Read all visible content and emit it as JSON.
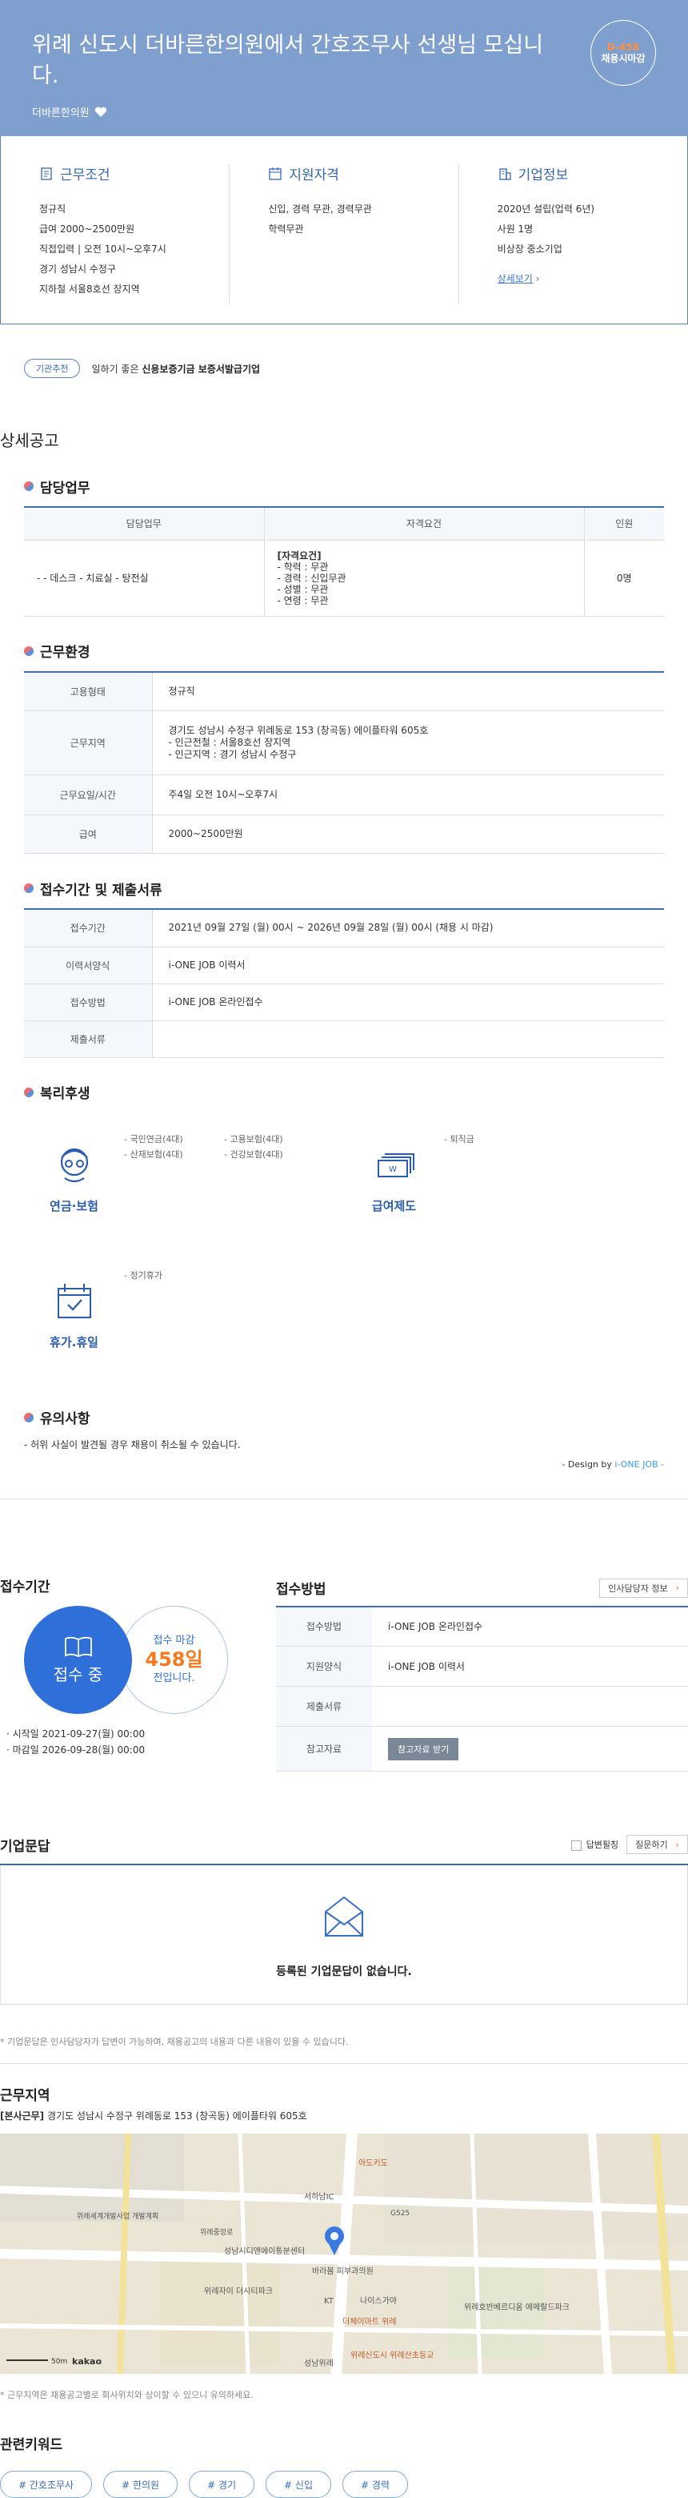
{
  "hero": {
    "title": "위례 신도시 더바른한의원에서 간호조무사 선생님 모십니다.",
    "company": "더바른한의원",
    "dday": "D-458",
    "dday_status": "채용시마감"
  },
  "summary": {
    "conditions": {
      "title": "근무조건",
      "items": [
        "정규직",
        "급여 2000~2500만원",
        "직접입력 | 오전 10시~오후7시",
        "경기 성남시 수정구",
        "지하철 서울8호선 장지역"
      ]
    },
    "qualification": {
      "title": "지원자격",
      "items": [
        "신입, 경력 무관, 경력무관",
        "학력무관"
      ]
    },
    "company": {
      "title": "기업정보",
      "items": [
        "2020년 설립(업력 6년)",
        "사원 1명",
        "비상장 중소기업"
      ],
      "link": "상세보기"
    }
  },
  "badge": {
    "label": "기관추천",
    "prefix": "일하기 좋은",
    "strong": "신용보증기금 보증서발급기업"
  },
  "detail_title": "상세공고",
  "duty": {
    "title": "담당업무",
    "headers": [
      "담당업무",
      "자격요건",
      "인원"
    ],
    "task": "- - 데스크 - 치료실 - 탕전실",
    "req_title": "[자격요건]",
    "reqs": [
      "- 학력 : 무관",
      "- 경력 : 신입무관",
      "- 성별 : 무관",
      "- 연령 : 무관"
    ],
    "count": "0명"
  },
  "work": {
    "title": "근무환경",
    "rows": [
      {
        "k": "고용형태",
        "v": [
          "정규직"
        ]
      },
      {
        "k": "근무지역",
        "v": [
          "경기도 성남시 수정구 위례동로 153 (창곡동) 에이플타워 605호",
          "- 인근전철 : 서울8호선 장지역",
          "- 인근지역 : 경기 성남시 수정구"
        ]
      },
      {
        "k": "근무요일/시간",
        "v": [
          "주4일 오전 10시~오후7시"
        ]
      },
      {
        "k": "급여",
        "v": [
          "2000~2500만원"
        ]
      }
    ]
  },
  "period": {
    "title": "접수기간 및 제출서류",
    "rows": [
      {
        "k": "접수기간",
        "v": "2021년 09월 27일 (월) 00시 ~ 2026년 09월 28일 (월) 00시 (채용 시 마감)"
      },
      {
        "k": "이력서양식",
        "v": "i-ONE JOB 이력서"
      },
      {
        "k": "접수방법",
        "v": "i-ONE JOB 온라인접수"
      },
      {
        "k": "제출서류",
        "v": ""
      }
    ]
  },
  "welfare": {
    "title": "복리후생",
    "groups": [
      {
        "label": "연금·보험",
        "items": [
          "- 국민연금(4대)",
          "- 고용보험(4대)",
          "- 산재보험(4대)",
          "- 건강보험(4대)"
        ]
      },
      {
        "label": "급여제도",
        "items": [
          "- 퇴직금"
        ]
      },
      {
        "label": "휴가.휴일",
        "items": [
          "- 정기휴가"
        ]
      }
    ]
  },
  "caution": {
    "title": "유의사항",
    "text": "- 허위 사실이 발견될 경우 채용이 취소될 수 있습니다.",
    "design_prefix": "- Design by",
    "design_brand": "i-ONE JOB -"
  },
  "apply": {
    "title": "접수기간",
    "status": "접수 중",
    "deadline_label": "접수 마감",
    "deadline_days": "458일",
    "deadline_suffix": "전입니다.",
    "start": "시작일 2021-09-27(월) 00:00",
    "end": "마감일 2026-09-28(월) 00:00"
  },
  "method": {
    "title": "접수방법",
    "contact_btn": "인사담당자 정보",
    "rows": [
      {
        "k": "접수방법",
        "v": "i-ONE JOB 온라인접수"
      },
      {
        "k": "지원양식",
        "v": "i-ONE JOB 이력서"
      },
      {
        "k": "제출서류",
        "v": ""
      },
      {
        "k": "참고자료",
        "v": ""
      }
    ],
    "ref_btn": "참고자료 받기"
  },
  "qa": {
    "title": "기업문답",
    "filter": "답변필칭",
    "ask_btn": "질문하기",
    "empty": "등록된 기업문답이 없습니다.",
    "note": "* 기업문답은 인사담당자가 답변이 가능하며, 채용공고의 내용과 다른 내용이 있을 수 있습니다."
  },
  "location": {
    "title": "근무지역",
    "tag": "[본사근무]",
    "address": "경기도 성남시 수정구 위례동로 153 (창곡동) 에이플타워 605호",
    "note": "* 근무지역은 채용공고별로 회사위치와 상이할 수 있으니 유의하세요.",
    "map_labels": [
      "서하남IC",
      "아도키도",
      "위례세계개발사업 개발계획",
      "위례중앙로",
      "성남시디앤에이통분센터",
      "위례자이 더시티파크",
      "바라봄 피부과의원",
      "KT",
      "나이스가야",
      "더체이마트 위례",
      "위례호반베르디움 에메랄드파크",
      "위례신도시 위례산초등교",
      "성남위례",
      "G525",
      "50m",
      "kakao"
    ]
  },
  "keywords": {
    "title": "관련키워드",
    "items": [
      "# 간호조무사",
      "# 한의원",
      "# 경기",
      "# 신입",
      "# 경력"
    ]
  }
}
